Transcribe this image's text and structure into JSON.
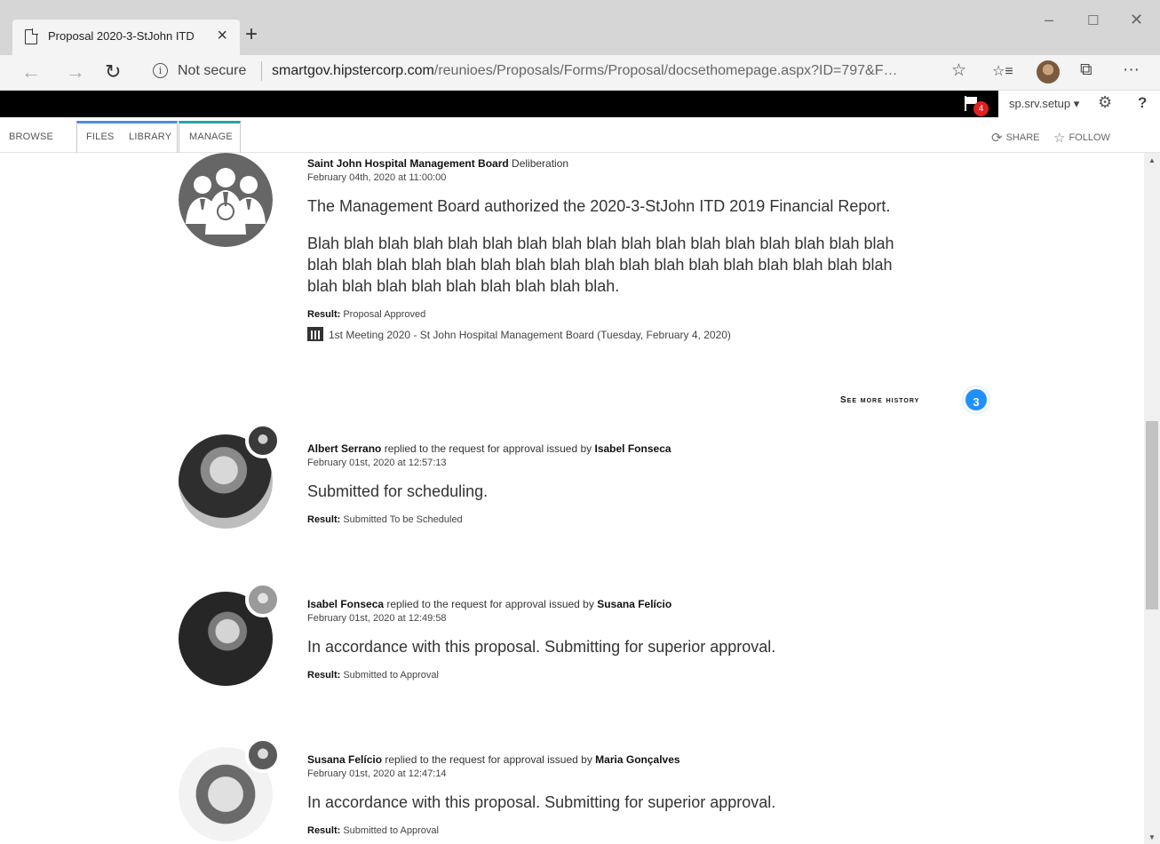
{
  "browser": {
    "tab_title": "Proposal 2020-3-StJohn ITD",
    "tab_close": "×",
    "new_tab": "+",
    "minimize": "–",
    "maximize": "☐",
    "close": "✕",
    "back": "←",
    "forward": "→",
    "refresh": "↻",
    "security_label": "Not secure",
    "url_host": "smartgov.hipstercorp.com",
    "url_path": "/reunioes/Proposals/Forms/Proposal/docsethomepage.aspx?ID=797&F…",
    "favorite": "☆",
    "favorites_list": "☆≡",
    "share": "⧉",
    "more": "···"
  },
  "suite_bar": {
    "notifications_count": "4",
    "user": "sp.srv.setup ▾",
    "settings": "⚙",
    "help": "?"
  },
  "ribbon": {
    "tabs": [
      "BROWSE",
      "FILES",
      "LIBRARY",
      "MANAGE"
    ],
    "share_label": "SHARE",
    "follow_label": "FOLLOW"
  },
  "feed": {
    "board": {
      "actor": "Saint John Hospital Management Board",
      "action": " Deliberation",
      "date": "February 04th, 2020 at 11:00:00",
      "message": "The Management Board authorized the 2020-3-StJohn ITD 2019 Financial Report.",
      "body": "Blah blah blah blah blah blah blah blah blah blah blah blah blah blah blah blah blah blah blah blah blah blah blah blah blah blah blah blah blah blah blah blah blah blah blah blah blah blah blah blah blah blah blah.",
      "result_label": "Result:",
      "result_value": " Proposal Approved",
      "meeting": "1st Meeting 2020 - St John Hospital Management Board (Tuesday, February 4, 2020)"
    },
    "see_more": {
      "label": "See more history",
      "count": "3"
    },
    "entries": [
      {
        "actor": "Albert Serrano",
        "action": " replied to the request for approval issued by ",
        "target": "Isabel Fonseca",
        "date": "February 01st, 2020 at 12:57:13",
        "message": "Submitted for scheduling.",
        "result_label": "Result:",
        "result_value": " Submitted To be Scheduled"
      },
      {
        "actor": "Isabel Fonseca",
        "action": " replied to the request for approval issued by ",
        "target": "Susana Felício",
        "date": "February 01st, 2020 at 12:49:58",
        "message": "In accordance with this proposal. Submitting for superior approval.",
        "result_label": "Result:",
        "result_value": " Submitted to Approval"
      },
      {
        "actor": "Susana Felício",
        "action": " replied to the request for approval issued by ",
        "target": "Maria Gonçalves",
        "date": "February 01st, 2020 at 12:47:14",
        "message": "In accordance with this proposal. Submitting for superior approval.",
        "result_label": "Result:",
        "result_value": " Submitted to Approval"
      }
    ]
  }
}
